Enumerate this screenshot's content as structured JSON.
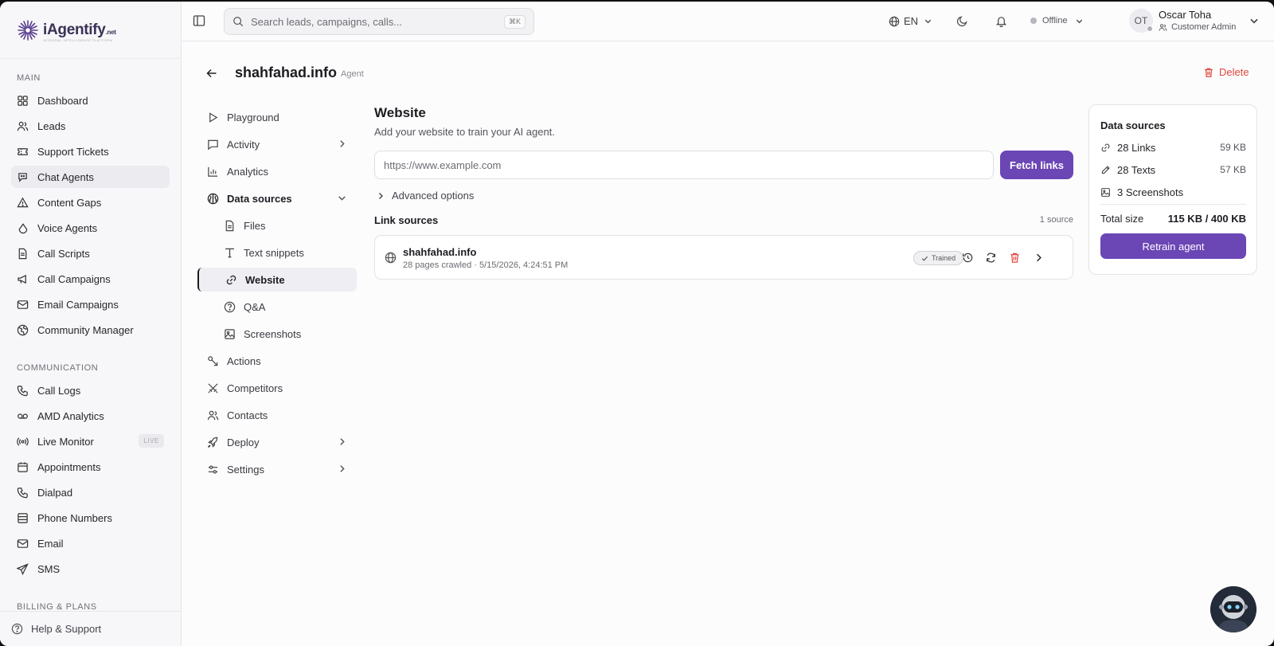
{
  "brand": {
    "name": "iAgentify",
    "suffix": ".net",
    "tagline": "INTEGRAL INTELLIGENCE PLATFORM"
  },
  "sidebar": {
    "sections": [
      {
        "title": "MAIN",
        "items": [
          {
            "label": "Dashboard",
            "icon": "dashboard-icon"
          },
          {
            "label": "Leads",
            "icon": "users-icon"
          },
          {
            "label": "Support Tickets",
            "icon": "ticket-icon"
          },
          {
            "label": "Chat Agents",
            "icon": "chat-bot-icon",
            "active": true
          },
          {
            "label": "Content Gaps",
            "icon": "alert-triangle-icon"
          },
          {
            "label": "Voice Agents",
            "icon": "mic-icon"
          },
          {
            "label": "Call Scripts",
            "icon": "file-text-icon"
          },
          {
            "label": "Call Campaigns",
            "icon": "megaphone-icon"
          },
          {
            "label": "Email Campaigns",
            "icon": "mail-icon"
          },
          {
            "label": "Community Manager",
            "icon": "globe-icon"
          }
        ]
      },
      {
        "title": "COMMUNICATION",
        "items": [
          {
            "label": "Call Logs",
            "icon": "phone-icon"
          },
          {
            "label": "AMD Analytics",
            "icon": "voicemail-icon"
          },
          {
            "label": "Live Monitor",
            "icon": "broadcast-icon",
            "badge": "LIVE"
          },
          {
            "label": "Appointments",
            "icon": "calendar-icon"
          },
          {
            "label": "Dialpad",
            "icon": "phone-icon"
          },
          {
            "label": "Phone Numbers",
            "icon": "list-icon"
          },
          {
            "label": "Email",
            "icon": "mail-icon"
          },
          {
            "label": "SMS",
            "icon": "send-icon"
          }
        ]
      },
      {
        "title": "BILLING & PLANS",
        "items": []
      }
    ],
    "help_label": "Help & Support"
  },
  "topbar": {
    "search_placeholder": "Search leads, campaigns, calls...",
    "search_shortcut": "⌘K",
    "language": "EN",
    "status": "Offline",
    "user": {
      "initials": "OT",
      "name": "Oscar Toha",
      "role": "Customer Admin"
    }
  },
  "page": {
    "title": "shahfahad.info",
    "tag": "Agent",
    "delete_label": "Delete"
  },
  "subnav": [
    {
      "label": "Playground",
      "icon": "play-icon",
      "kind": "item"
    },
    {
      "label": "Activity",
      "icon": "message-square-icon",
      "kind": "item",
      "chevron": "right"
    },
    {
      "label": "Analytics",
      "icon": "bar-chart-icon",
      "kind": "item"
    },
    {
      "label": "Data sources",
      "icon": "brain-icon",
      "kind": "group",
      "chevron": "down"
    },
    {
      "label": "Files",
      "icon": "file-icon",
      "kind": "child"
    },
    {
      "label": "Text snippets",
      "icon": "type-icon",
      "kind": "child"
    },
    {
      "label": "Website",
      "icon": "link-icon",
      "kind": "child",
      "current": true
    },
    {
      "label": "Q&A",
      "icon": "help-circle-icon",
      "kind": "child"
    },
    {
      "label": "Screenshots",
      "icon": "image-icon",
      "kind": "child"
    },
    {
      "label": "Actions",
      "icon": "actions-icon",
      "kind": "item"
    },
    {
      "label": "Competitors",
      "icon": "swords-icon",
      "kind": "item"
    },
    {
      "label": "Contacts",
      "icon": "users-icon",
      "kind": "item"
    },
    {
      "label": "Deploy",
      "icon": "rocket-icon",
      "kind": "item",
      "chevron": "right"
    },
    {
      "label": "Settings",
      "icon": "sliders-icon",
      "kind": "item",
      "chevron": "right"
    }
  ],
  "website": {
    "title": "Website",
    "subtitle": "Add your website to train your AI agent.",
    "url_placeholder": "https://www.example.com",
    "url_value": "",
    "fetch_label": "Fetch links",
    "advanced_label": "Advanced options",
    "link_sources_label": "Link sources",
    "source_count": "1 source",
    "sources": [
      {
        "name": "shahfahad.info",
        "meta": "28 pages crawled · 5/15/2026, 4:24:51 PM",
        "status": "Trained"
      }
    ]
  },
  "data_sources": {
    "title": "Data sources",
    "rows": [
      {
        "label": "28 Links",
        "size": "59 KB",
        "icon": "link-icon"
      },
      {
        "label": "28 Texts",
        "size": "57 KB",
        "icon": "pencil-icon"
      },
      {
        "label": "3 Screenshots",
        "size": "",
        "icon": "image-icon"
      }
    ],
    "total_label": "Total size",
    "total_value": "115 KB / 400 KB",
    "retrain_label": "Retrain agent"
  },
  "colors": {
    "accent": "#6b46b5",
    "danger": "#e0463c",
    "sidebar_bg": "#f7f7f9"
  }
}
